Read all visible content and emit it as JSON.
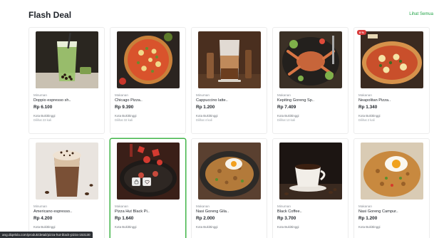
{
  "section": {
    "title": "Flash Deal",
    "see_all": "Lihat Semua"
  },
  "status_url": "ang.diqelola.com/produk/detail/pizza-hut-black-pizza-153130",
  "products": [
    {
      "category": "Minuman",
      "name": "Doppio espresso sh..",
      "price": "Rp 6.100",
      "city": "Kota Bukittinggi",
      "seen": "Dilihat 23 kali",
      "image": "matcha-drink"
    },
    {
      "category": "Makanan",
      "name": "Chicago Pizza..",
      "price": "Rp 9.390",
      "city": "Kota Bukittinggi",
      "seen": "Dilihat 32 kali",
      "image": "pizza"
    },
    {
      "category": "Minuman",
      "name": "Cappuccino latte..",
      "price": "Rp 1.200",
      "city": "Kota Bukittinggi",
      "seen": "Dilihat 4 kali",
      "image": "latte"
    },
    {
      "category": "Makanan",
      "name": "Kepiting Goreng Sp..",
      "price": "Rp 7.409",
      "city": "Kota Bukittinggi",
      "seen": "Dilihat 13 kali",
      "image": "crab"
    },
    {
      "category": "Makanan",
      "name": "Neapolitan Pizza..",
      "price": "Rp 1.340",
      "city": "Kota Bukittinggi",
      "seen": "Dilihat 2 kali",
      "image": "neapolitan",
      "badge": "8 %"
    },
    {
      "category": "Minuman",
      "name": "Americano espresso..",
      "price": "Rp 4.200",
      "city": "Kota Bukittinggi",
      "seen": "",
      "image": "iced-coffee"
    },
    {
      "category": "Makanan",
      "name": "Pizza Hut Black Pi..",
      "price": "Rp 1.640",
      "city": "Kota Bukittinggi",
      "seen": "",
      "image": "black-pizza",
      "active": true
    },
    {
      "category": "Makanan",
      "name": "Nasi Goreng Gila..",
      "price": "Rp 2.000",
      "city": "Kota Bukittinggi",
      "seen": "",
      "image": "fried-rice"
    },
    {
      "category": "Minuman",
      "name": "Black Coffee..",
      "price": "Rp 3.700",
      "city": "Kota Bukittinggi",
      "seen": "",
      "image": "black-coffee"
    },
    {
      "category": "Makanan",
      "name": "Nasi Goreng Campur..",
      "price": "Rp 1.200",
      "city": "Kota Bukittinggi",
      "seen": "",
      "image": "fried-rice-egg"
    }
  ],
  "colors": {
    "accent": "#20a346",
    "active_border": "#42b549",
    "badge": "#d93b3b"
  }
}
